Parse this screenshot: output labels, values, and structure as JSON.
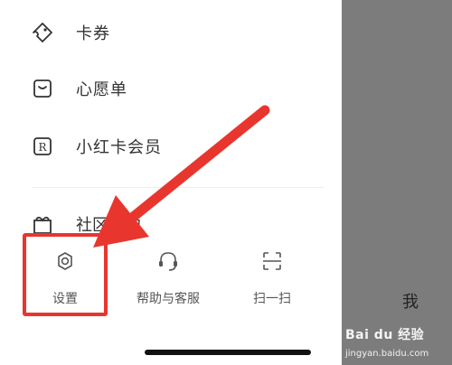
{
  "menu": {
    "items": [
      {
        "label": "卡券",
        "icon": "coupon-icon"
      },
      {
        "label": "心愿单",
        "icon": "wishlist-icon"
      },
      {
        "label": "小红卡会员",
        "icon": "membership-r-icon"
      }
    ],
    "partial_item_label": "社区公约"
  },
  "bottom_bar": {
    "settings_label": "设置",
    "help_label": "帮助与客服",
    "scan_label": "扫一扫"
  },
  "tab": {
    "me_label": "我"
  },
  "watermark": {
    "logo_text": "Bai du 经验",
    "url": "jingyan.baidu.com"
  },
  "colors": {
    "highlight": "#e8362e",
    "arrow": "#e8362e",
    "overlay": "#7c7c7c"
  }
}
